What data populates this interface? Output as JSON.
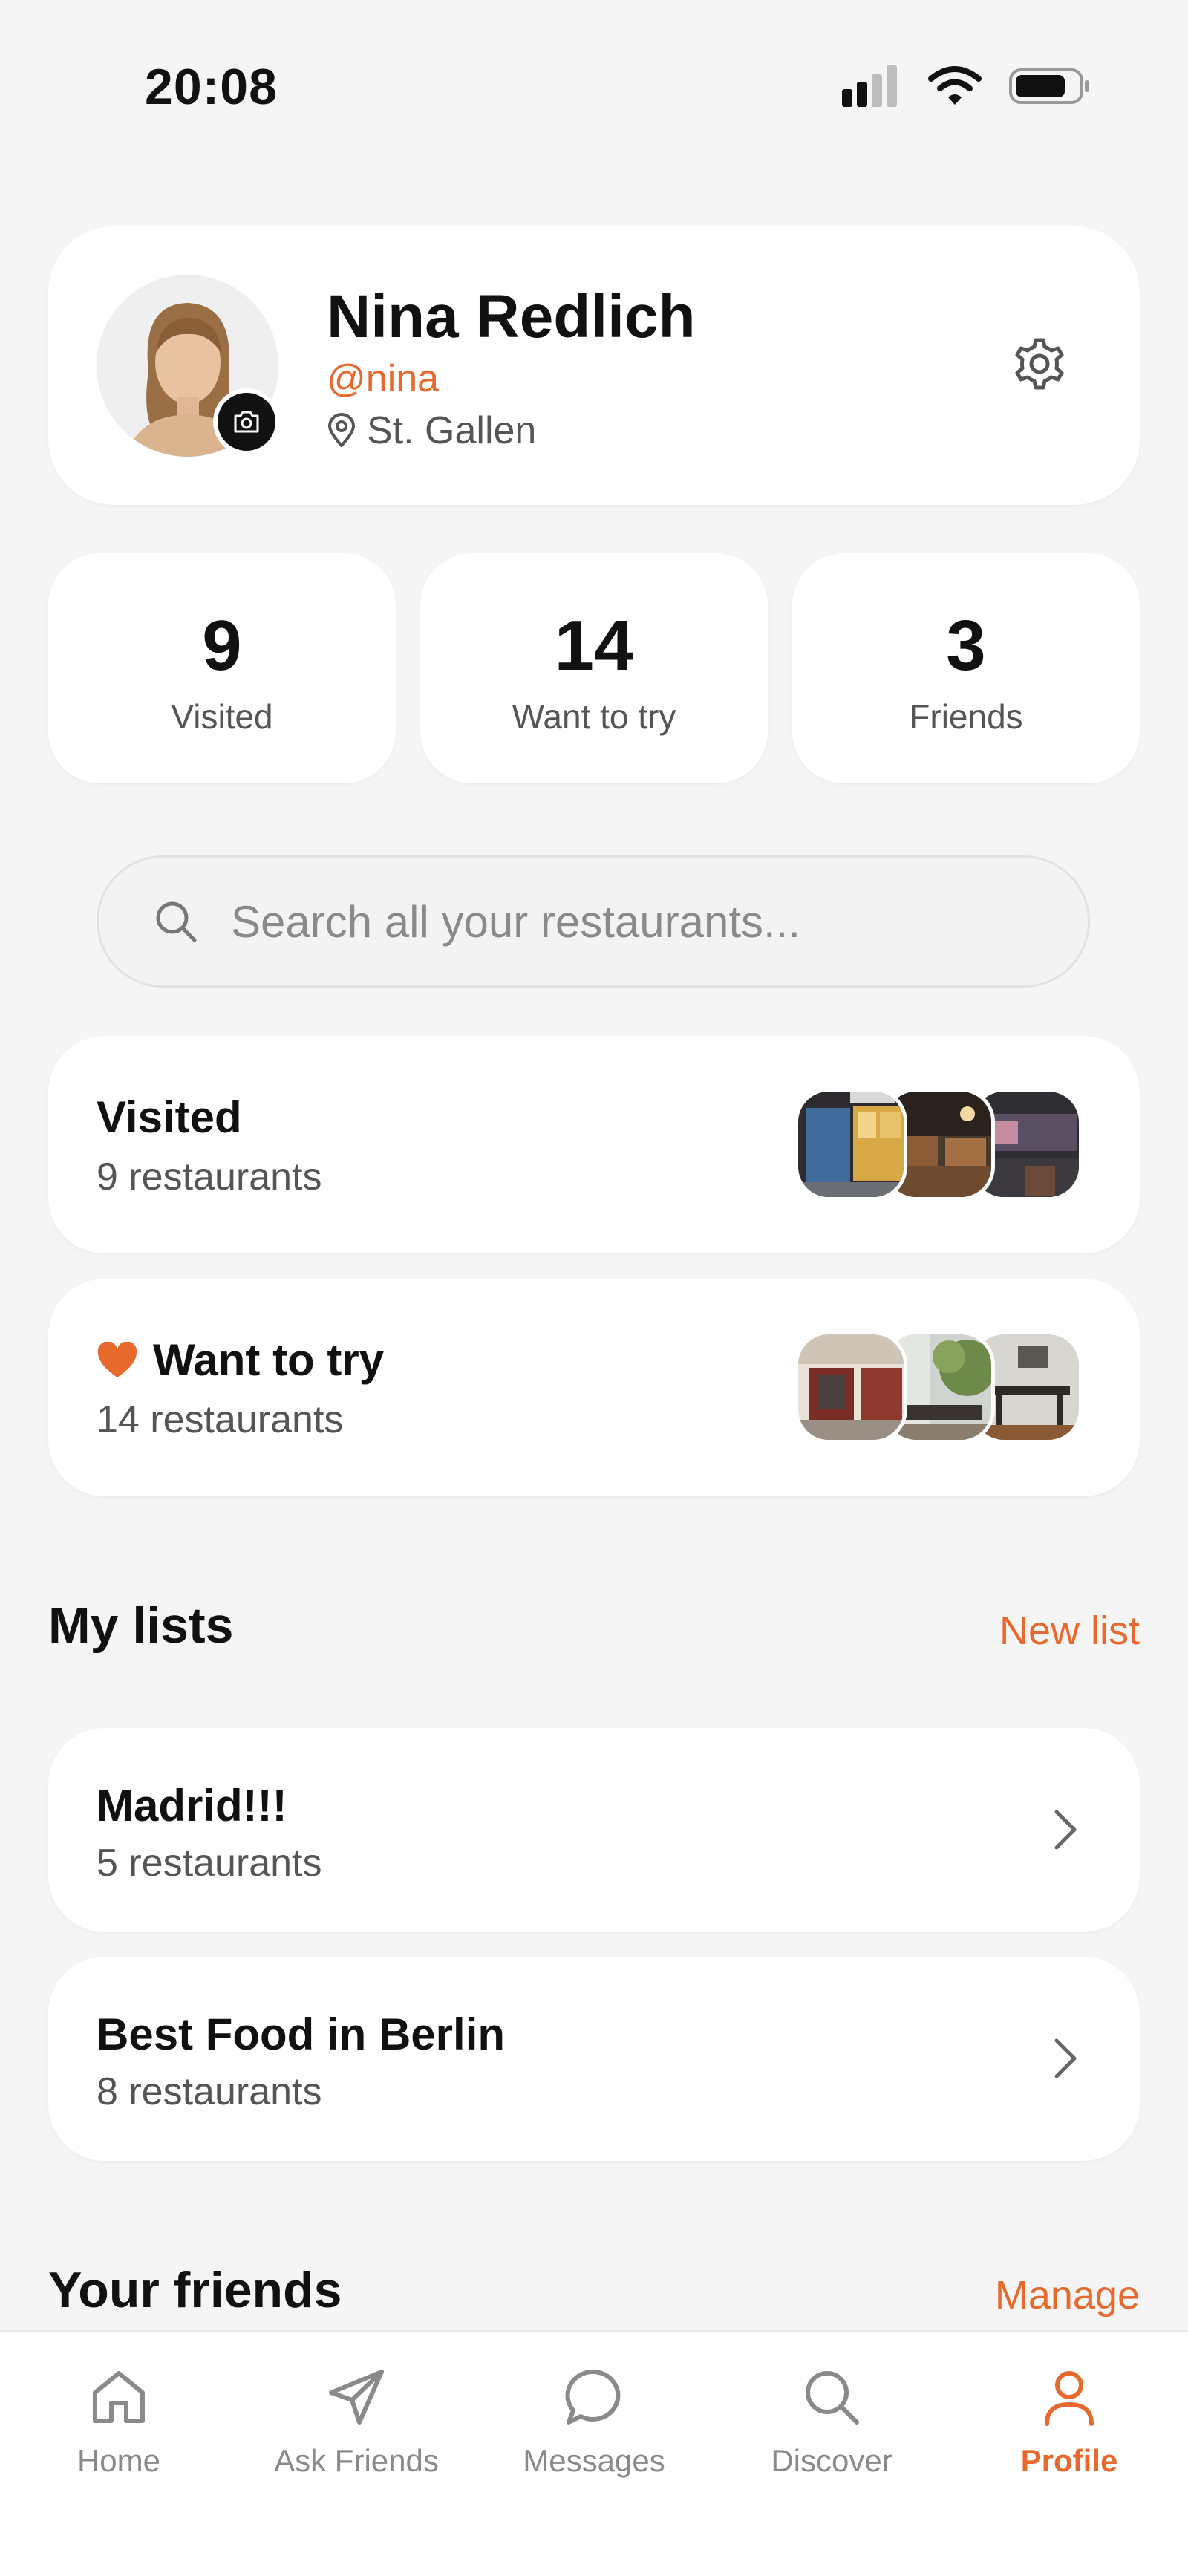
{
  "status_bar": {
    "time": "20:08"
  },
  "profile": {
    "name": "Nina Redlich",
    "handle": "@nina",
    "location": "St. Gallen"
  },
  "stats": [
    {
      "value": "9",
      "label": "Visited"
    },
    {
      "value": "14",
      "label": "Want to try"
    },
    {
      "value": "3",
      "label": "Friends"
    }
  ],
  "search": {
    "placeholder": "Search all your restaurants..."
  },
  "collections": [
    {
      "title": "Visited",
      "subtitle": "9 restaurants"
    },
    {
      "title": "Want to try",
      "subtitle": "14 restaurants"
    }
  ],
  "my_lists": {
    "title": "My lists",
    "action": "New list",
    "items": [
      {
        "title": "Madrid!!!",
        "subtitle": "5 restaurants"
      },
      {
        "title": "Best Food in Berlin",
        "subtitle": "8 restaurants"
      }
    ]
  },
  "friends": {
    "title": "Your friends",
    "action": "Manage"
  },
  "tabs": [
    {
      "label": "Home",
      "icon": "home-icon"
    },
    {
      "label": "Ask Friends",
      "icon": "send-icon"
    },
    {
      "label": "Messages",
      "icon": "chat-bubble-icon"
    },
    {
      "label": "Discover",
      "icon": "search-icon"
    },
    {
      "label": "Profile",
      "icon": "person-icon",
      "active": true
    }
  ],
  "colors": {
    "accent": "#e8692e",
    "background": "#f5f5f5",
    "card": "#ffffff"
  }
}
